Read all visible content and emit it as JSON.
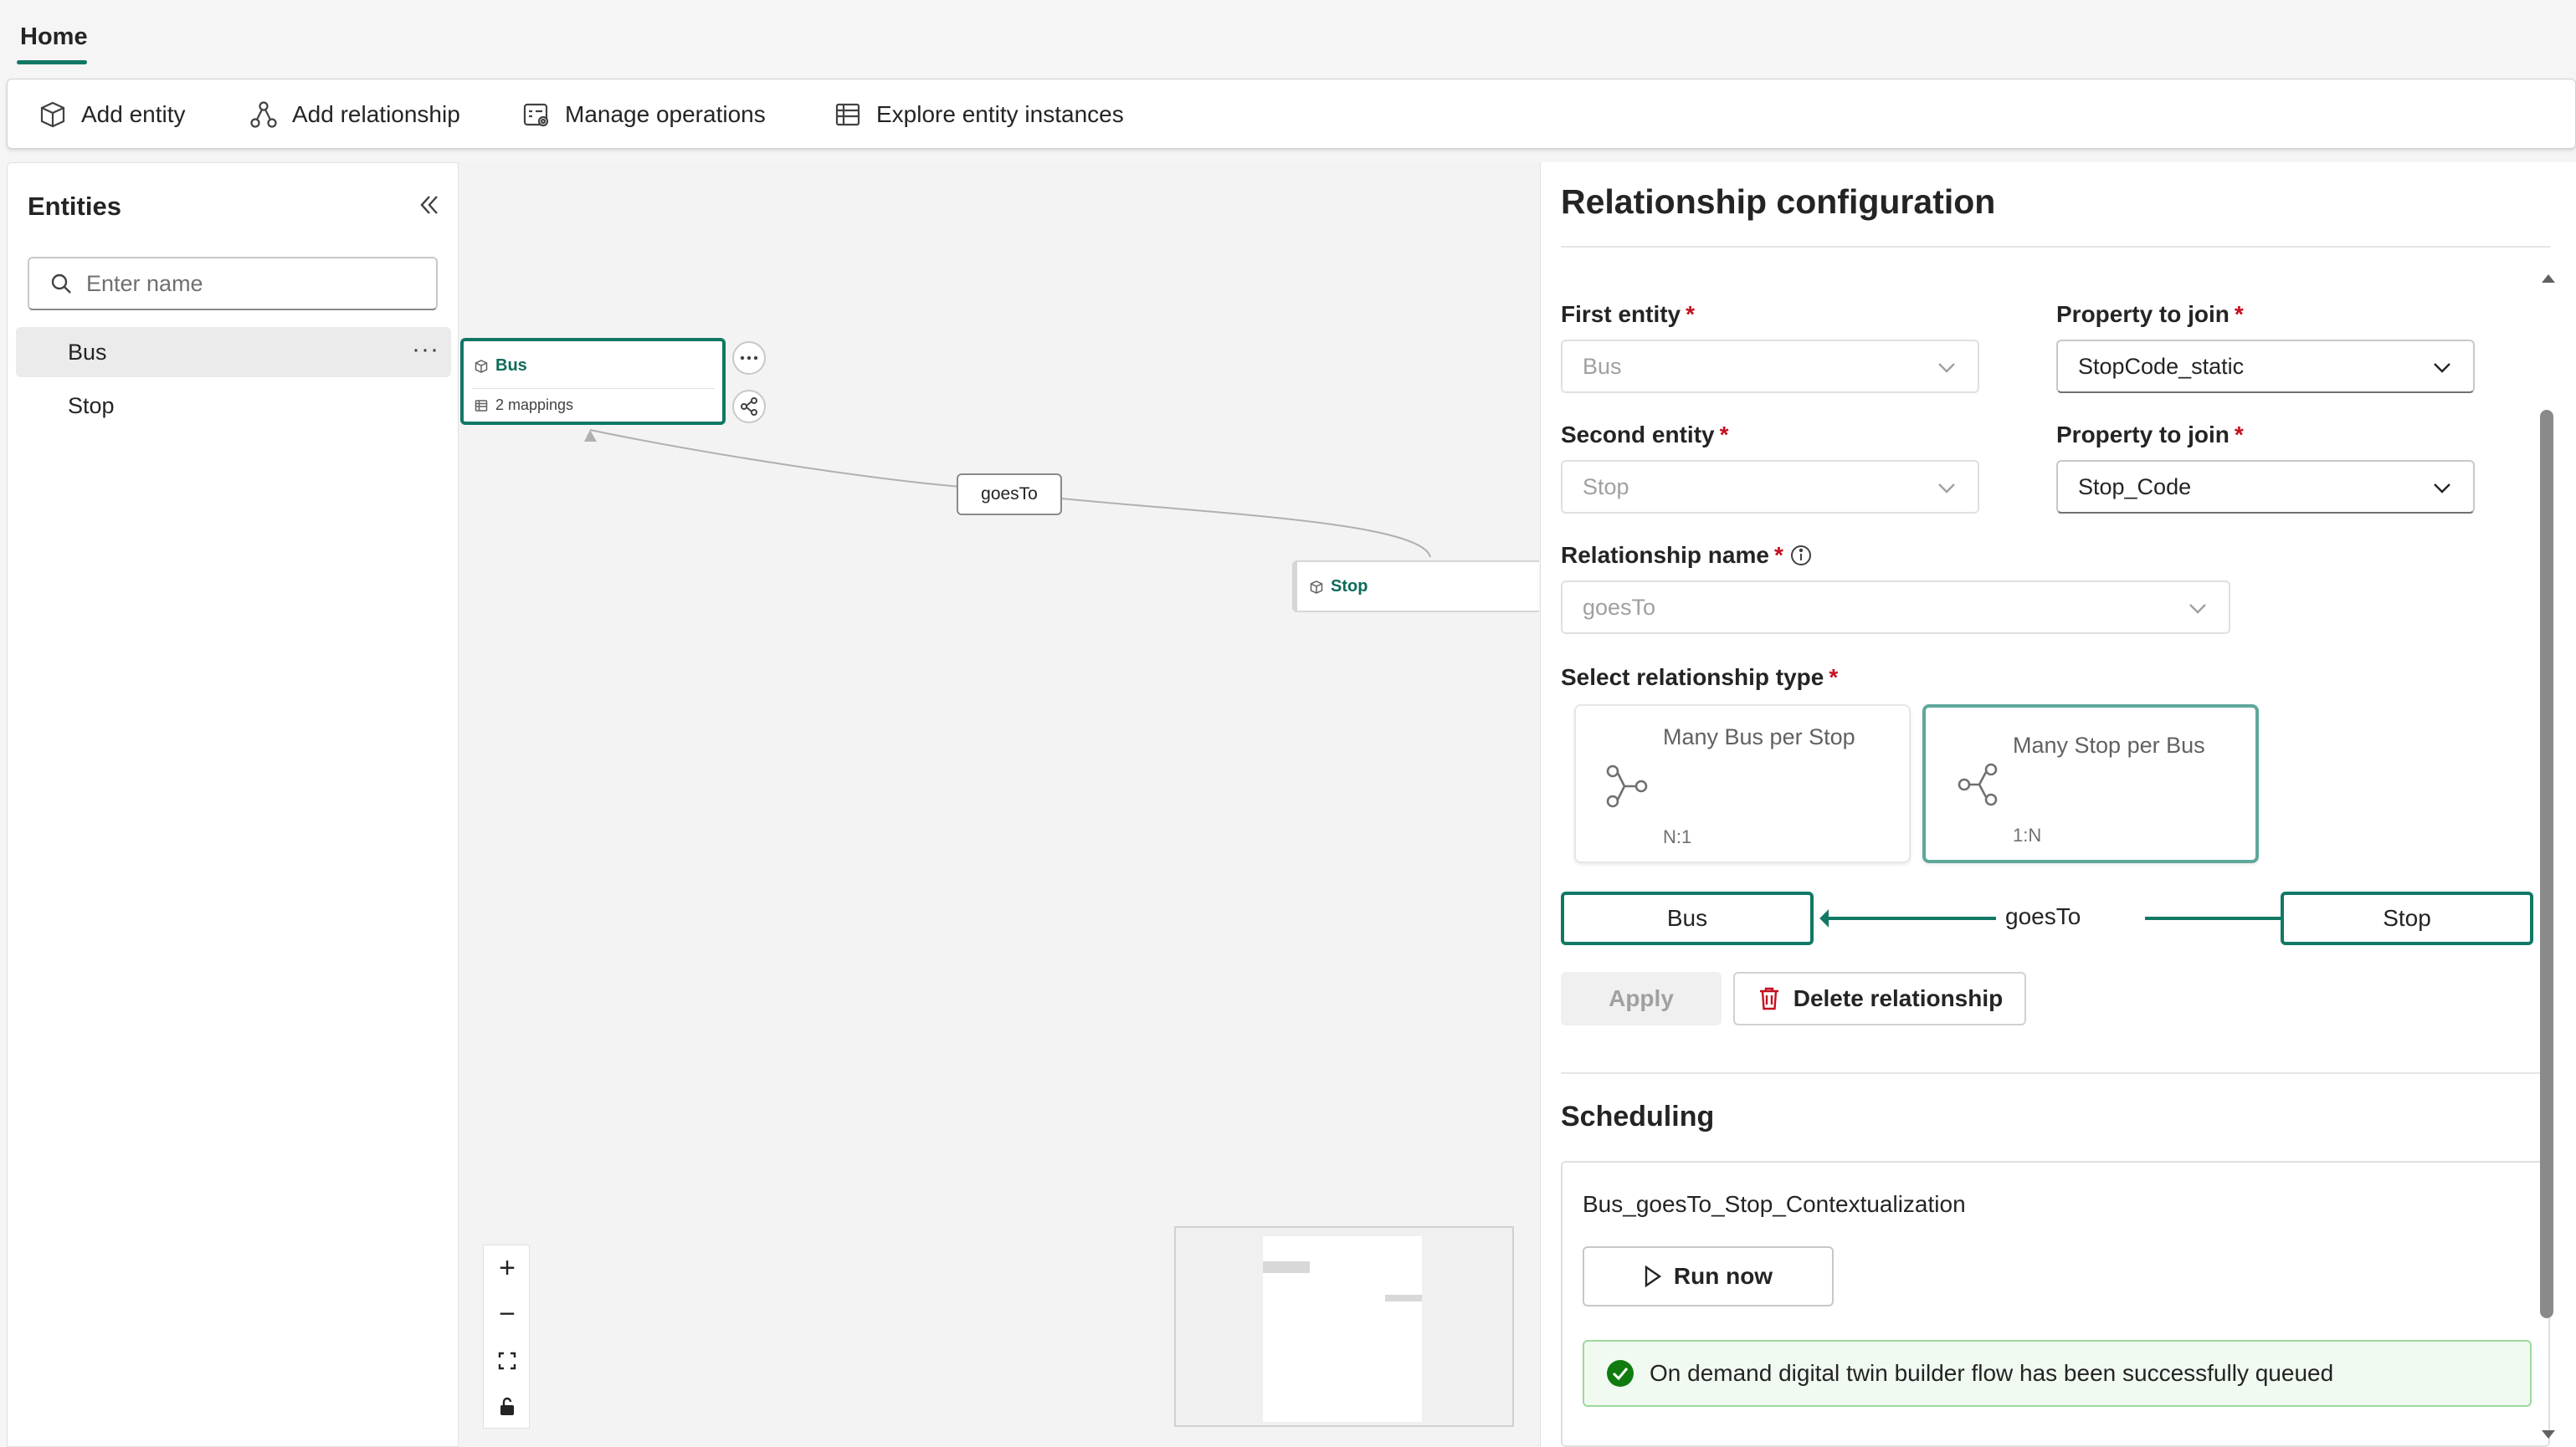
{
  "tabs": {
    "home": "Home"
  },
  "toolbar": {
    "add_entity": "Add entity",
    "add_relationship": "Add relationship",
    "manage_operations": "Manage operations",
    "explore_instances": "Explore entity instances"
  },
  "entities_panel": {
    "title": "Entities",
    "search_placeholder": "Enter name",
    "items": [
      {
        "label": "Bus",
        "more": "···"
      },
      {
        "label": "Stop"
      }
    ]
  },
  "canvas": {
    "nodes": [
      {
        "label": "Bus",
        "sub": "2 mappings"
      },
      {
        "label": "Stop"
      }
    ],
    "edge_label": "goesTo",
    "zoom": {
      "in": "+",
      "out": "−"
    }
  },
  "relationship_config": {
    "title": "Relationship configuration",
    "first_entity": {
      "label": "First entity",
      "value": "Bus"
    },
    "property1": {
      "label": "Property to join",
      "value": "StopCode_static"
    },
    "second_entity": {
      "label": "Second entity",
      "value": "Stop"
    },
    "property2": {
      "label": "Property to join",
      "value": "Stop_Code"
    },
    "relationship_name": {
      "label": "Relationship name",
      "value": "goesTo"
    },
    "relationship_type": {
      "label": "Select relationship type",
      "options": [
        {
          "title": "Many Bus per Stop",
          "cardinality": "N:1",
          "selected": false
        },
        {
          "title": "Many Stop per Bus",
          "cardinality": "1:N",
          "selected": true
        }
      ]
    },
    "diagram": {
      "left": "Bus",
      "name": "goesTo",
      "right": "Stop"
    },
    "apply": "Apply",
    "delete": "Delete relationship",
    "required_mark": "*"
  },
  "scheduling": {
    "title": "Scheduling",
    "flow_name": "Bus_goesTo_Stop_Contextualization",
    "run_now": "Run now",
    "status": "On demand digital twin builder flow has been successfully queued"
  },
  "colors": {
    "accent": "#117865",
    "required": "#c50f1f",
    "success": "#107c10",
    "delete_icon": "#c50f1f"
  }
}
